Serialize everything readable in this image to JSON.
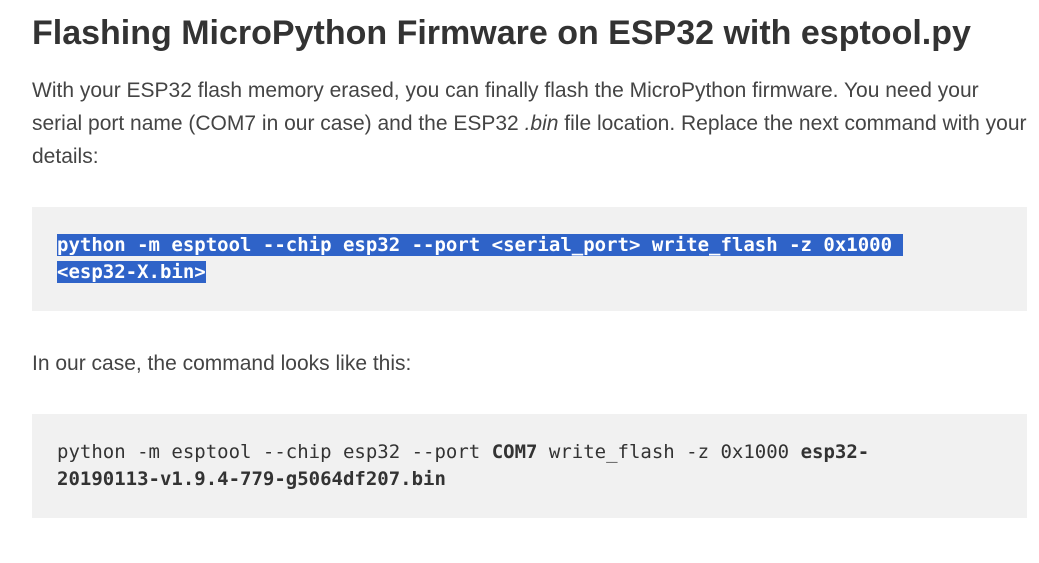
{
  "article": {
    "title": "Flashing MicroPython Firmware on ESP32 with esptool.py",
    "intro": {
      "part1": "With your ESP32 flash memory erased, you can finally flash the MicroPython firmware. You need your serial port name (COM7 in our case) and the ESP32 ",
      "italic": ".bin",
      "part2": " file location. Replace the next command with your details:"
    },
    "code_template": {
      "line1": "python -m esptool --chip esp32 --port <serial_port> write_flash -z 0x1000 ",
      "line2": "<esp32-X.bin>"
    },
    "case_text": "In our case, the command looks like this:",
    "code_example": {
      "prefix": "python -m esptool --chip esp32 --port ",
      "port": "COM7",
      "middle": " write_flash -z 0x1000 ",
      "file_part1": "esp32-",
      "file_part2": "20190113-v1.9.4-779-g5064df207.bin"
    }
  },
  "colors": {
    "selection": "#2f63c8",
    "code_bg": "#f1f1f1",
    "text": "#333333"
  }
}
